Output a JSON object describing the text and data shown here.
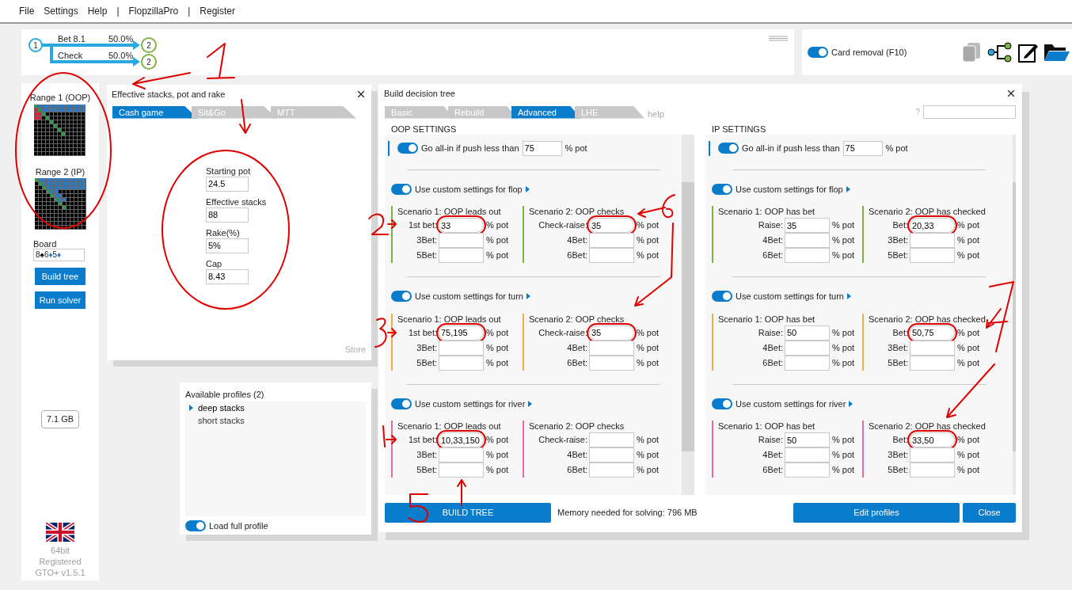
{
  "menu": [
    "File",
    "Settings",
    "Help",
    "|",
    "FlopzillaPro",
    "|",
    "Register"
  ],
  "tree_preview": {
    "root": "1",
    "branches": [
      {
        "label": "Bet 8.1",
        "percent": "50.0%",
        "node": "2"
      },
      {
        "label": "Check",
        "percent": "50.0%",
        "node": "2"
      }
    ]
  },
  "card_removal": {
    "label": "Card removal (F10)",
    "on": true
  },
  "sidebar": {
    "ranges": [
      {
        "label": "Range 1 (OOP)"
      },
      {
        "label": "Range 2 (IP)"
      }
    ],
    "board_label": "Board",
    "board": [
      {
        "rank": "8",
        "suit": "♠",
        "color": "#000000"
      },
      {
        "rank": "6",
        "suit": "♦",
        "color": "#1e7fd6"
      },
      {
        "rank": "5",
        "suit": "♦",
        "color": "#1e7fd6"
      }
    ],
    "buttons": [
      "Build tree",
      "Run solver"
    ],
    "memory": "7.1 GB",
    "footer": [
      "64bit",
      "Registered",
      "GTO+ v1.5.1"
    ]
  },
  "stacks_dialog": {
    "title": "Effective stacks, pot and rake",
    "tabs": [
      {
        "label": "Cash game",
        "selected": true
      },
      {
        "label": "Sit&Go",
        "selected": false
      },
      {
        "label": "MTT",
        "selected": false
      }
    ],
    "fields": [
      {
        "label": "Starting pot",
        "value": "24.5"
      },
      {
        "label": "Effective stacks",
        "value": "88"
      },
      {
        "label": "Rake(%)",
        "value": "5%"
      },
      {
        "label": "Cap",
        "value": "8.43"
      }
    ],
    "store": "Store"
  },
  "profiles": {
    "title": "Available profiles (2)",
    "items": [
      {
        "label": "deep stacks",
        "selected": true
      },
      {
        "label": "short stacks",
        "selected": false
      }
    ],
    "load_full": {
      "label": "Load full profile",
      "on": true
    }
  },
  "build_dialog": {
    "title": "Build decision tree",
    "tabs": [
      {
        "label": "Basic",
        "selected": false
      },
      {
        "label": "Rebuild",
        "selected": false
      },
      {
        "label": "Advanced",
        "selected": true
      },
      {
        "label": "LHE",
        "selected": false
      }
    ],
    "help": "help",
    "search_hint": "?",
    "sections": [
      {
        "header": "OOP SETTINGS",
        "allin": {
          "label": "Go all-in if push less than",
          "value": "75",
          "unit": "% pot",
          "on": true
        },
        "streets": [
          {
            "label": "Use custom settings for flop",
            "on": true,
            "color": "#7cb342",
            "scenarios": [
              {
                "title": "Scenario 1: OOP leads out",
                "rows": [
                  {
                    "label": "1st bet:",
                    "value": "33",
                    "unit": "% pot",
                    "circled": true
                  },
                  {
                    "label": "3Bet:",
                    "unit": "% pot",
                    "circled": false
                  },
                  {
                    "label": "5Bet:",
                    "unit": "% pot",
                    "circled": false
                  }
                ]
              },
              {
                "title": "Scenario 2: OOP checks",
                "rows": [
                  {
                    "label": "Check-raise:",
                    "value": "35",
                    "unit": "% pot",
                    "circled": true
                  },
                  {
                    "label": "4Bet:",
                    "unit": "% pot",
                    "circled": false
                  },
                  {
                    "label": "6Bet:",
                    "unit": "% pot",
                    "circled": false
                  }
                ]
              }
            ]
          },
          {
            "label": "Use custom settings for turn",
            "on": true,
            "color": "#f0b041",
            "scenarios": [
              {
                "title": "Scenario 1: OOP leads out",
                "rows": [
                  {
                    "label": "1st bet:",
                    "value": "75,195",
                    "unit": "% pot",
                    "circled": true
                  },
                  {
                    "label": "3Bet:",
                    "unit": "% pot",
                    "circled": false
                  },
                  {
                    "label": "5Bet:",
                    "unit": "% pot",
                    "circled": false
                  }
                ]
              },
              {
                "title": "Scenario 2: OOP checks",
                "rows": [
                  {
                    "label": "Check-raise:",
                    "value": "35",
                    "unit": "% pot",
                    "circled": true
                  },
                  {
                    "label": "4Bet:",
                    "unit": "% pot",
                    "circled": false
                  },
                  {
                    "label": "6Bet:",
                    "unit": "% pot",
                    "circled": false
                  }
                ]
              }
            ]
          },
          {
            "label": "Use custom settings for river",
            "on": true,
            "color": "#e66aa8",
            "scenarios": [
              {
                "title": "Scenario 1: OOP leads out",
                "rows": [
                  {
                    "label": "1st bet:",
                    "value": "10,33,150",
                    "unit": "% pot",
                    "circled": true
                  },
                  {
                    "label": "3Bet:",
                    "unit": "% pot",
                    "circled": false
                  },
                  {
                    "label": "5Bet:",
                    "unit": "% pot",
                    "circled": false
                  }
                ]
              },
              {
                "title": "Scenario 2: OOP checks",
                "rows": [
                  {
                    "label": "Check-raise:",
                    "unit": "% pot",
                    "circled": false
                  },
                  {
                    "label": "4Bet:",
                    "unit": "% pot",
                    "circled": false
                  },
                  {
                    "label": "6Bet:",
                    "unit": "% pot",
                    "circled": false
                  }
                ]
              }
            ]
          }
        ]
      },
      {
        "header": "IP SETTINGS",
        "allin": {
          "label": "Go all-in if push less than",
          "value": "75",
          "unit": "% pot",
          "on": true
        },
        "streets": [
          {
            "label": "Use custom settings for flop",
            "on": true,
            "color": "#7cb342",
            "scenarios": [
              {
                "title": "Scenario 1: OOP has bet",
                "rows": [
                  {
                    "label": "Raise:",
                    "value": "35",
                    "unit": "% pot",
                    "circled": false
                  },
                  {
                    "label": "4Bet:",
                    "unit": "% pot",
                    "circled": false
                  },
                  {
                    "label": "6Bet:",
                    "unit": "% pot",
                    "circled": false
                  }
                ]
              },
              {
                "title": "Scenario 2: OOP has checked",
                "rows": [
                  {
                    "label": "Bet:",
                    "value": "20,33",
                    "unit": "% pot",
                    "circled": true
                  },
                  {
                    "label": "3Bet:",
                    "unit": "% pot",
                    "circled": false
                  },
                  {
                    "label": "5Bet:",
                    "unit": "% pot",
                    "circled": false
                  }
                ]
              }
            ]
          },
          {
            "label": "Use custom settings for turn",
            "on": true,
            "color": "#f0b041",
            "scenarios": [
              {
                "title": "Scenario 1: OOP has bet",
                "rows": [
                  {
                    "label": "Raise:",
                    "value": "50",
                    "unit": "% pot",
                    "circled": false
                  },
                  {
                    "label": "4Bet:",
                    "unit": "% pot",
                    "circled": false
                  },
                  {
                    "label": "6Bet:",
                    "unit": "% pot",
                    "circled": false
                  }
                ]
              },
              {
                "title": "Scenario 2: OOP has checked",
                "rows": [
                  {
                    "label": "Bet:",
                    "value": "50,75",
                    "unit": "% pot",
                    "circled": true
                  },
                  {
                    "label": "3Bet:",
                    "unit": "% pot",
                    "circled": false
                  },
                  {
                    "label": "5Bet:",
                    "unit": "% pot",
                    "circled": false
                  }
                ]
              }
            ]
          },
          {
            "label": "Use custom settings for river",
            "on": true,
            "color": "#e66aa8",
            "scenarios": [
              {
                "title": "Scenario 1: OOP has bet",
                "rows": [
                  {
                    "label": "Raise:",
                    "value": "50",
                    "unit": "% pot",
                    "circled": false
                  },
                  {
                    "label": "4Bet:",
                    "unit": "% pot",
                    "circled": false
                  },
                  {
                    "label": "6Bet:",
                    "unit": "% pot",
                    "circled": false
                  }
                ]
              },
              {
                "title": "Scenario 2: OOP has checked",
                "rows": [
                  {
                    "label": "Bet:",
                    "value": "33,50",
                    "unit": "% pot",
                    "circled": true
                  },
                  {
                    "label": "3Bet:",
                    "unit": "% pot",
                    "circled": false
                  },
                  {
                    "label": "5Bet:",
                    "unit": "% pot",
                    "circled": false
                  }
                ]
              }
            ]
          }
        ]
      }
    ],
    "build_button": "BUILD TREE",
    "memory": "Memory needed for solving: 796 MB",
    "edit_button": "Edit profiles",
    "close_button": "Close"
  }
}
